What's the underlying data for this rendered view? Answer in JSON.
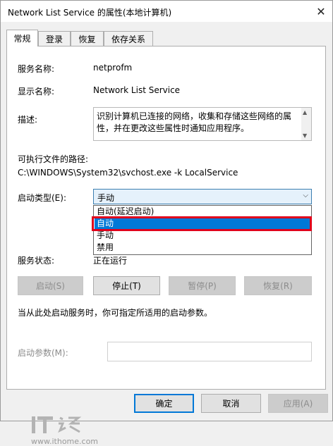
{
  "window": {
    "title": "Network List Service 的属性(本地计算机)",
    "close": "✕"
  },
  "tabs": [
    "常规",
    "登录",
    "恢复",
    "依存关系"
  ],
  "general": {
    "service_name_label": "服务名称:",
    "service_name": "netprofm",
    "display_name_label": "显示名称:",
    "display_name": "Network List Service",
    "desc_label": "描述:",
    "desc": "识别计算机已连接的网络，收集和存储这些网络的属性，并在更改这些属性时通知应用程序。",
    "exe_label": "可执行文件的路径:",
    "exe_path": "C:\\WINDOWS\\System32\\svchost.exe -k LocalService",
    "startup_type_label": "启动类型(E):",
    "startup_type_value": "手动",
    "startup_options": [
      "自动(延迟启动)",
      "自动",
      "手动",
      "禁用"
    ],
    "selected_option_index": 1,
    "status_label": "服务状态:",
    "status_value": "正在运行",
    "buttons": {
      "start": "启动(S)",
      "stop": "停止(T)",
      "pause": "暂停(P)",
      "resume": "恢复(R)"
    },
    "hint": "当从此处启动服务时，你可指定所适用的启动参数。",
    "param_label": "启动参数(M):"
  },
  "footer": {
    "ok": "确定",
    "cancel": "取消",
    "apply": "应用(A)"
  },
  "watermark": {
    "logo_text": "IT之家",
    "url": "www.ithome.com"
  },
  "colors": {
    "selection": "#0078d7",
    "highlight_border": "#e0001b"
  }
}
